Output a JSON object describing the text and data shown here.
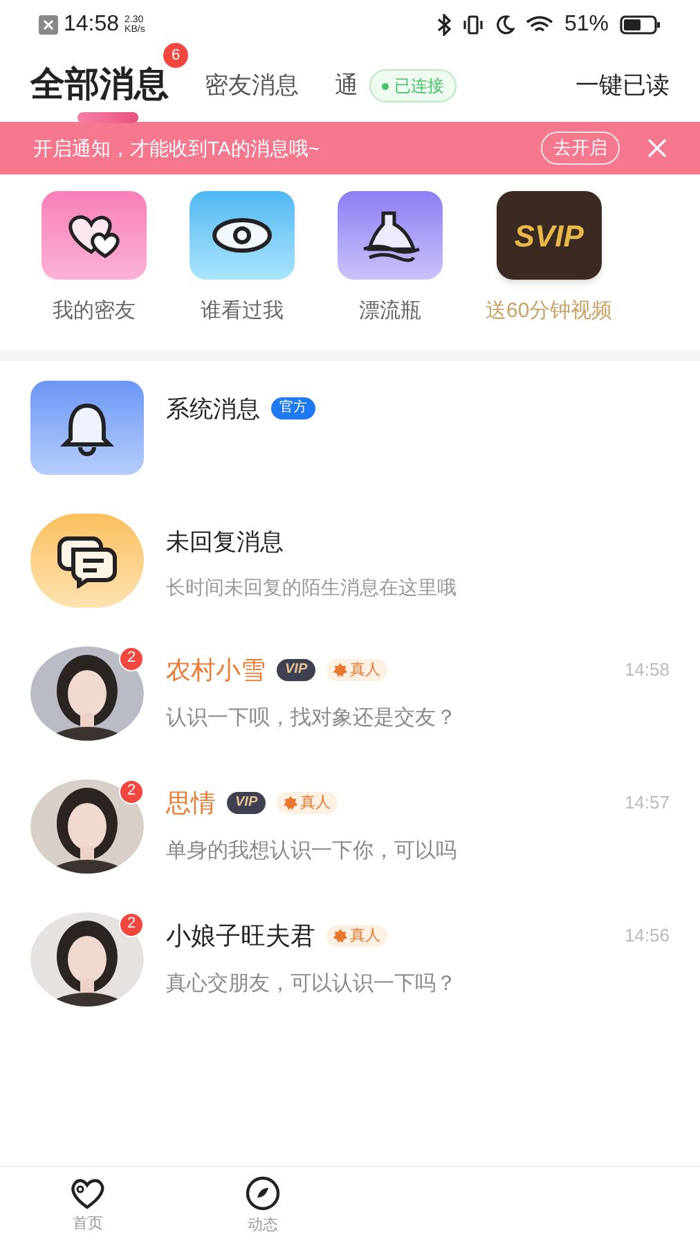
{
  "status_bar": {
    "time": "14:58",
    "speed": "2.30",
    "speed_unit": "KB/s",
    "battery": "51%"
  },
  "tabs": [
    {
      "label": "全部消息",
      "selected": true,
      "badge": "6"
    },
    {
      "label": "密友消息",
      "selected": false
    },
    {
      "label": "通",
      "selected": false
    }
  ],
  "connection_badge": "已连接",
  "mark_all_read": "一键已读",
  "notice_banner": {
    "text": "开启通知，才能收到TA的消息哦~",
    "button": "去开启"
  },
  "shortcuts": [
    {
      "kind": "hearts",
      "label": "我的密友"
    },
    {
      "kind": "eye",
      "label": "谁看过我"
    },
    {
      "kind": "bottle",
      "label": "漂流瓶"
    },
    {
      "kind": "svip",
      "label": "送60分钟视频",
      "logo": "SVIP"
    }
  ],
  "special_items": [
    {
      "kind": "bell",
      "title": "系统消息",
      "tag": "官方"
    },
    {
      "kind": "chat",
      "title": "未回复消息",
      "subtitle": "长时间未回复的陌生消息在这里哦"
    }
  ],
  "conversations": [
    {
      "name": "农村小雪",
      "vip": true,
      "vip_label": "VIP",
      "verified_label": "真人",
      "badge": "2",
      "time": "14:58",
      "preview": "认识一下呗，找对象还是交友？"
    },
    {
      "name": "思情",
      "vip": true,
      "vip_label": "VIP",
      "verified_label": "真人",
      "badge": "2",
      "time": "14:57",
      "preview": "单身的我想认识一下你，可以吗"
    },
    {
      "name": "小娘子旺夫君",
      "vip": false,
      "verified_label": "真人",
      "badge": "2",
      "time": "14:56",
      "preview": "真心交朋友，可以认识一下吗？"
    }
  ],
  "bottom_tabs": [
    {
      "kind": "heart",
      "label": "首页"
    },
    {
      "kind": "leaf",
      "label": "动态"
    }
  ]
}
